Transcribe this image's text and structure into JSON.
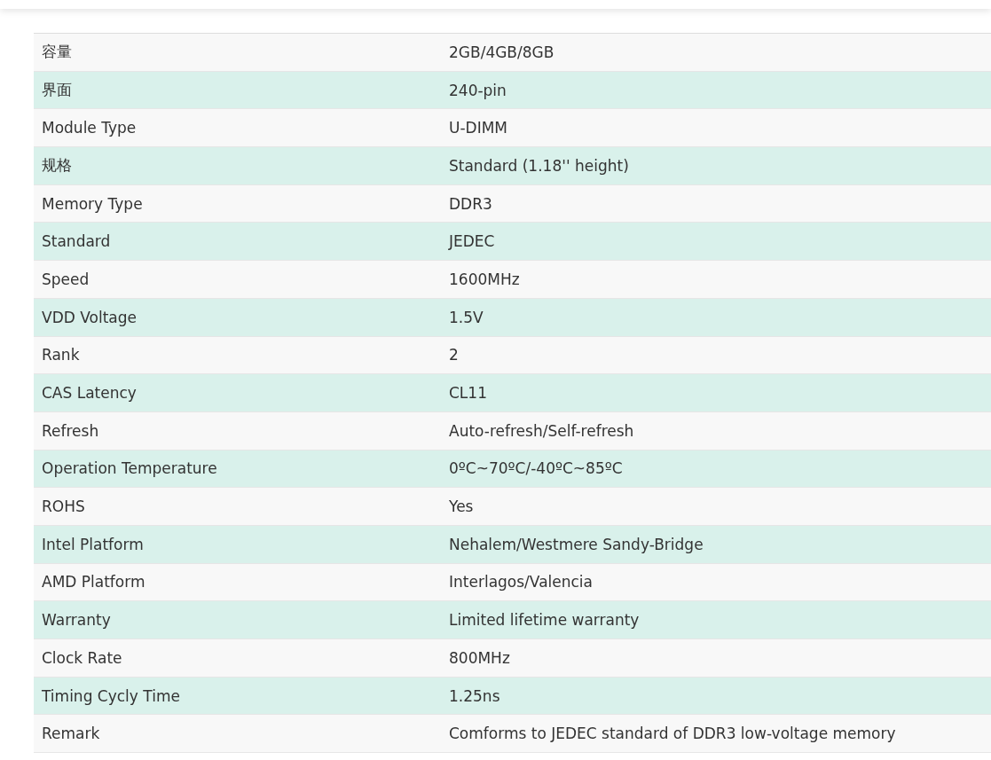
{
  "spec_table": {
    "rows": [
      {
        "label": "容量",
        "value": "2GB/4GB/8GB"
      },
      {
        "label": "界面",
        "value": "240-pin"
      },
      {
        "label": "Module Type",
        "value": "U-DIMM"
      },
      {
        "label": "规格",
        "value": "Standard (1.18'' height)"
      },
      {
        "label": "Memory Type",
        "value": "DDR3"
      },
      {
        "label": "Standard",
        "value": "JEDEC"
      },
      {
        "label": "Speed",
        "value": "1600MHz"
      },
      {
        "label": "VDD Voltage",
        "value": "1.5V"
      },
      {
        "label": "Rank",
        "value": "2"
      },
      {
        "label": "CAS Latency",
        "value": "CL11"
      },
      {
        "label": "Refresh",
        "value": "Auto-refresh/Self-refresh"
      },
      {
        "label": "Operation Temperature",
        "value": "0ºC~70ºC/-40ºC~85ºC"
      },
      {
        "label": "ROHS",
        "value": "Yes"
      },
      {
        "label": "Intel Platform",
        "value": "Nehalem/Westmere Sandy-Bridge"
      },
      {
        "label": "AMD Platform",
        "value": "Interlagos/Valencia"
      },
      {
        "label": "Warranty",
        "value": "Limited lifetime warranty"
      },
      {
        "label": "Clock Rate",
        "value": "800MHz"
      },
      {
        "label": "Timing Cycly Time",
        "value": "1.25ns"
      },
      {
        "label": "Remark",
        "value": "Comforms to JEDEC standard of DDR3 low-voltage memory"
      }
    ]
  }
}
